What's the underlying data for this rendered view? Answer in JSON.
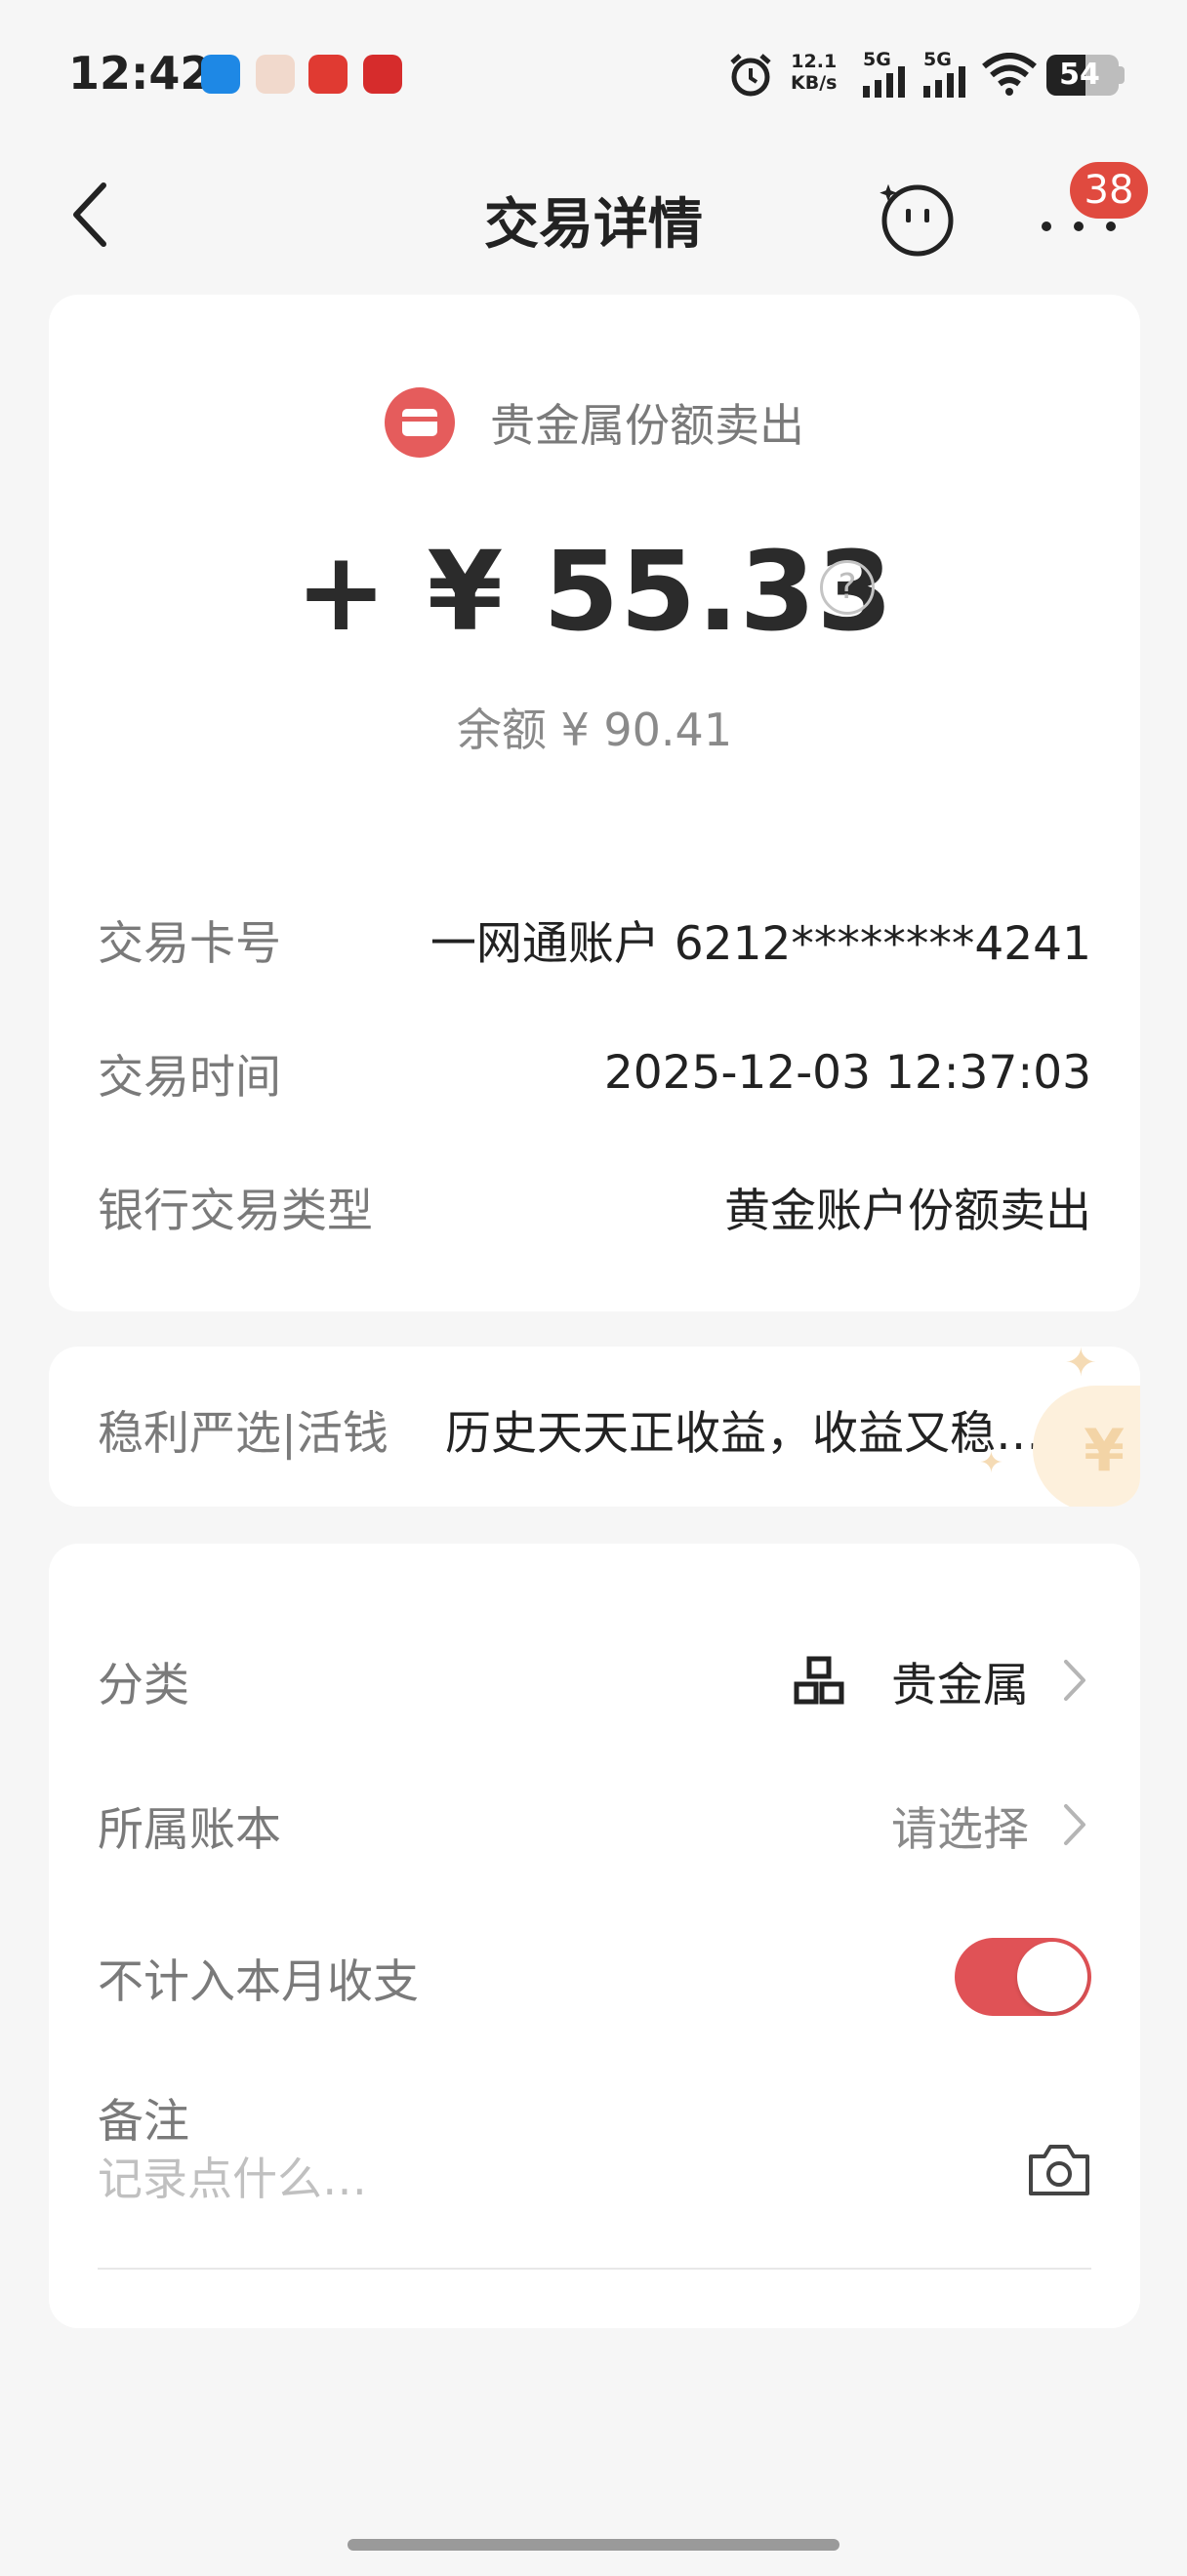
{
  "status_bar": {
    "time": "12:42",
    "net_speed_value": "12.1",
    "net_speed_unit": "KB/s",
    "signal_1": "5G",
    "signal_2": "5G",
    "battery_level": "54",
    "battery_fraction": 0.54,
    "app_icons": [
      "app-icon-1",
      "app-icon-2",
      "app-icon-3",
      "app-icon-4"
    ]
  },
  "nav": {
    "title": "交易详情",
    "more_badge": "38"
  },
  "transaction": {
    "type_label": "贵金属份额卖出",
    "amount": "+ ¥ 55.33",
    "help": "?",
    "balance": "余额 ¥ 90.41",
    "details": [
      {
        "label": "交易卡号",
        "value": "一网通账户 6212********4241"
      },
      {
        "label": "交易时间",
        "value": "2025-12-03 12:37:03"
      },
      {
        "label": "银行交易类型",
        "value": "黄金账户份额卖出"
      }
    ]
  },
  "promo": {
    "label": "稳利严选|活钱",
    "text": "历史天天正收益，收益又稳…",
    "deco": "¥"
  },
  "settings": {
    "category_label": "分类",
    "category_value": "贵金属",
    "ledger_label": "所属账本",
    "ledger_placeholder": "请选择",
    "exclude_label": "不计入本月收支",
    "exclude_on": true,
    "note_label": "备注",
    "note_placeholder": "记录点什么…"
  },
  "colors": {
    "accent_red": "#e05256",
    "badge_red": "#e04a3f",
    "card_bg": "#ffffff",
    "page_bg": "#f6f6f6"
  }
}
